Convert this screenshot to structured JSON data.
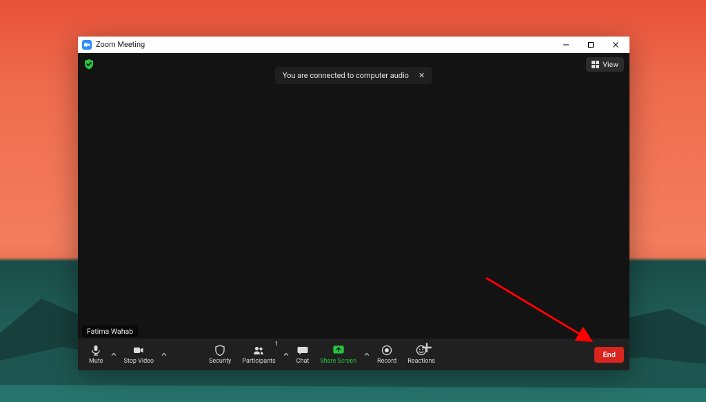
{
  "title": "Zoom Meeting",
  "toast": {
    "message": "You are connected to computer audio"
  },
  "view_label": "View",
  "participant_name": "Fatima Wahab",
  "toolbar": {
    "mute": "Mute",
    "stop_video": "Stop Video",
    "security": "Security",
    "participants": "Participants",
    "participants_count": "1",
    "chat": "Chat",
    "share_screen": "Share Screen",
    "record": "Record",
    "reactions": "Reactions",
    "end": "End"
  }
}
